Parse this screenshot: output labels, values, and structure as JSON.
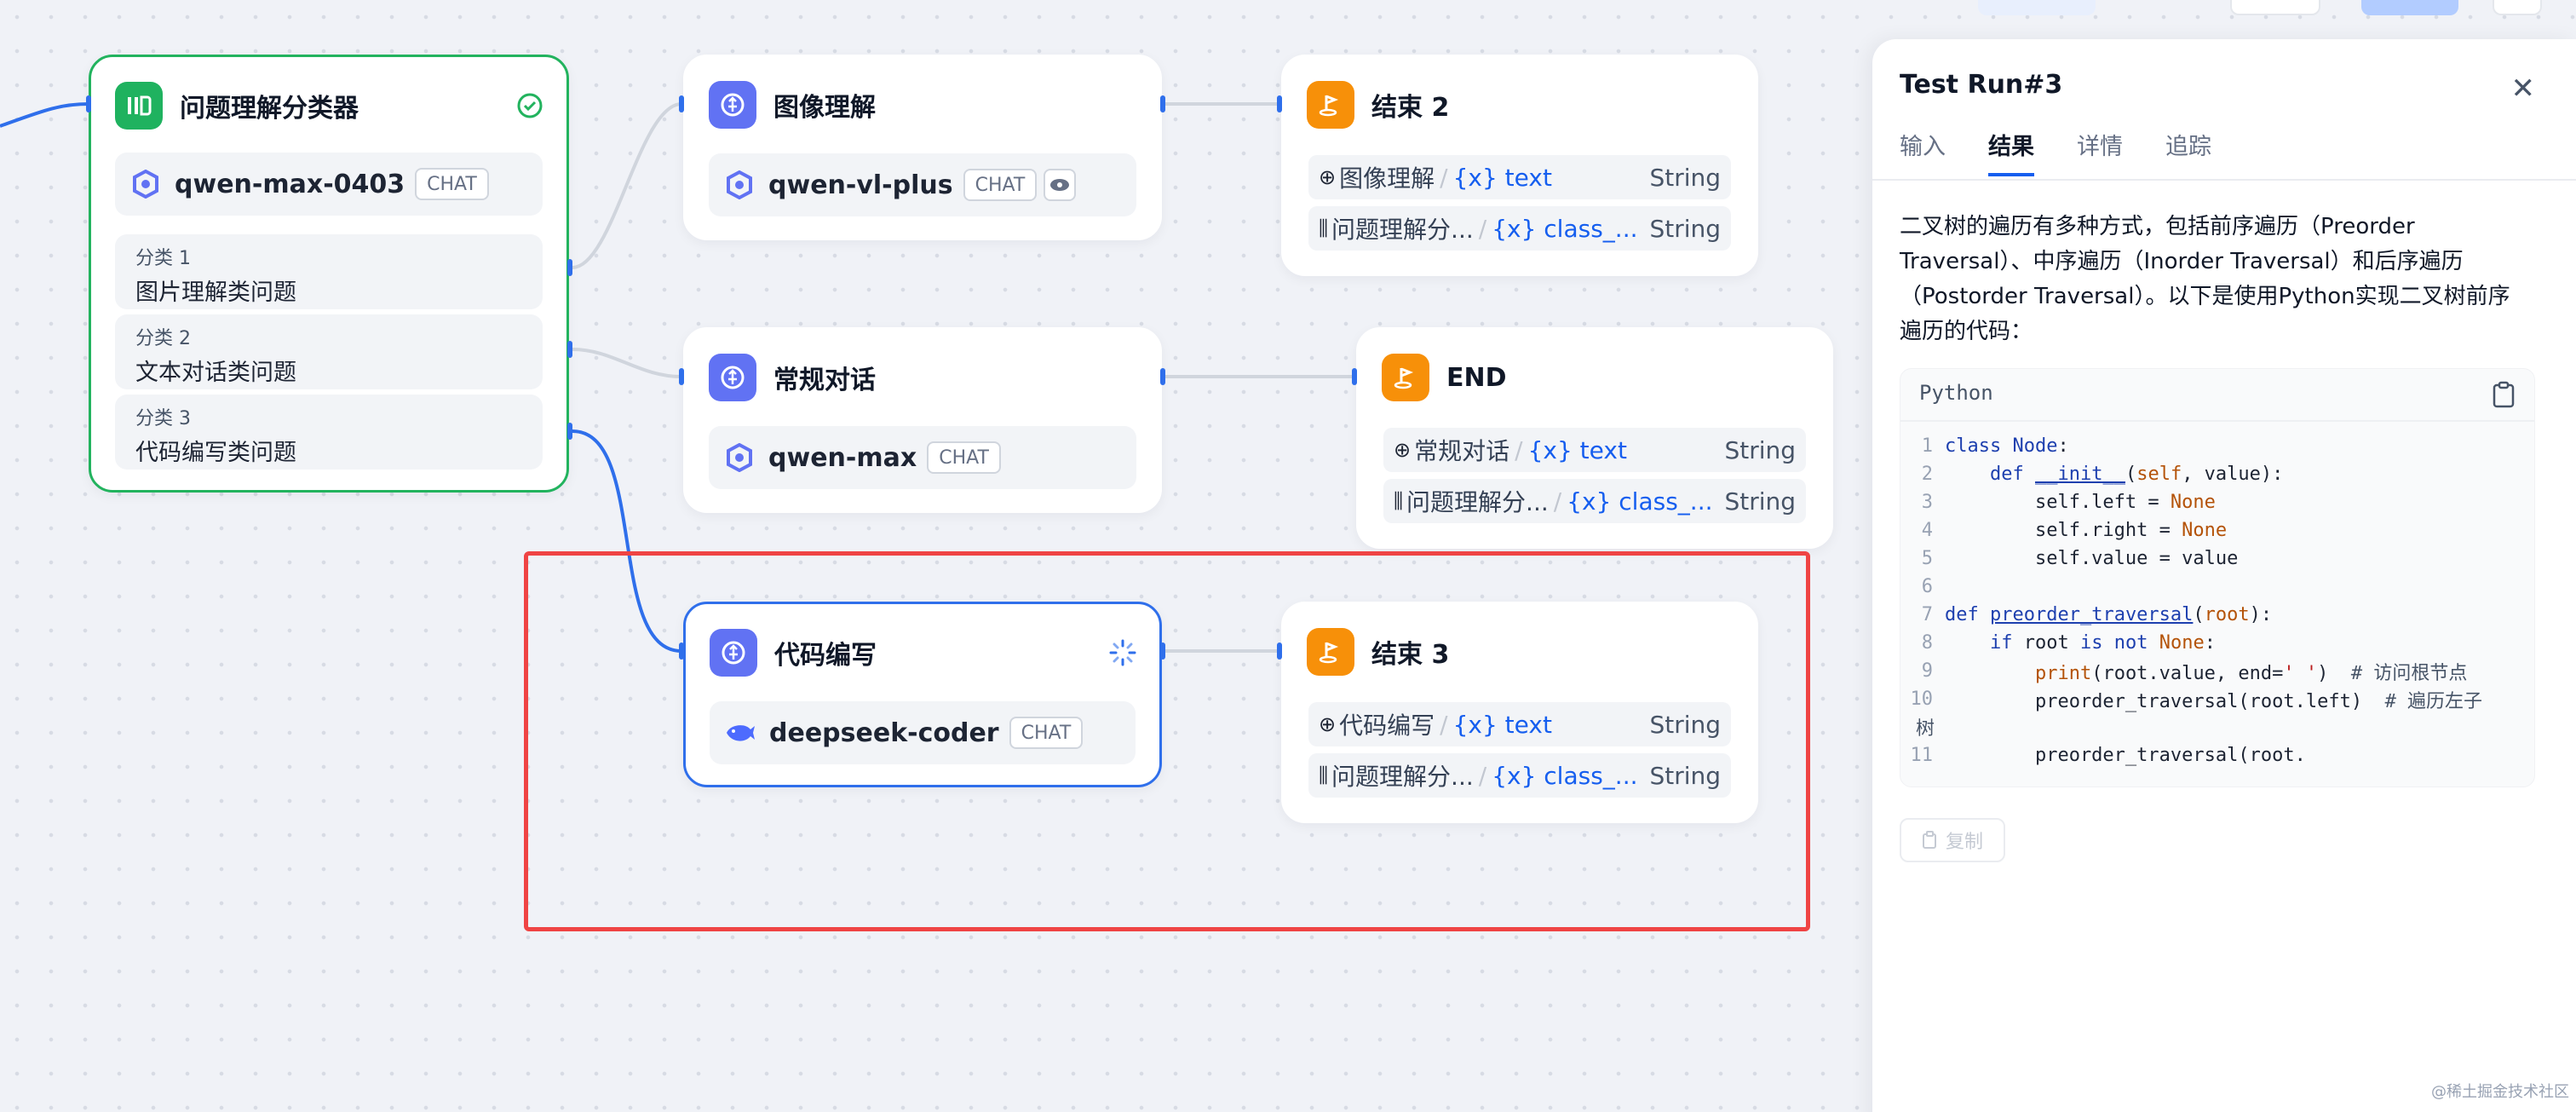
{
  "nodes": {
    "classifier": {
      "title": "问题理解分类器",
      "model": "qwen-max-0403",
      "model_badge": "CHAT",
      "classes": [
        {
          "label": "分类 1",
          "text": "图片理解类问题"
        },
        {
          "label": "分类 2",
          "text": "文本对话类问题"
        },
        {
          "label": "分类 3",
          "text": "代码编写类问题"
        }
      ]
    },
    "image": {
      "title": "图像理解",
      "model": "qwen-vl-plus",
      "model_badge": "CHAT"
    },
    "chat": {
      "title": "常规对话",
      "model": "qwen-max",
      "model_badge": "CHAT"
    },
    "code": {
      "title": "代码编写",
      "model": "deepseek-coder",
      "model_badge": "CHAT"
    },
    "end2": {
      "title": "结束 2",
      "vars": [
        {
          "source": "图像理解",
          "var": "{x} text",
          "type": "String"
        },
        {
          "source": "问题理解分...",
          "var": "{x} class_...",
          "type": "String"
        }
      ]
    },
    "end": {
      "title": "END",
      "vars": [
        {
          "source": "常规对话",
          "var": "{x} text",
          "type": "String"
        },
        {
          "source": "问题理解分...",
          "var": "{x} class_...",
          "type": "String"
        }
      ]
    },
    "end3": {
      "title": "结束 3",
      "vars": [
        {
          "source": "代码编写",
          "var": "{x} text",
          "type": "String"
        },
        {
          "source": "问题理解分...",
          "var": "{x} class_...",
          "type": "String"
        }
      ]
    }
  },
  "panel": {
    "title": "Test Run#3",
    "tabs": [
      "输入",
      "结果",
      "详情",
      "追踪"
    ],
    "active_tab": "结果",
    "result_lines": [
      "二叉树的遍历有多种方式，包括前序遍历（Preorder",
      "Traversal）、中序遍历（Inorder Traversal）和后序遍历",
      "（Postorder Traversal）。以下是使用Python实现二叉树前序",
      "遍历的代码："
    ],
    "code_language": "Python",
    "copy_label": "复制"
  },
  "watermark": "@稀土掘金技术社区",
  "colors": {
    "accent": "#155eef",
    "success": "#22b35e",
    "selection": "#ef4444",
    "end_node": "#f79009",
    "llm_node": "#6172f3"
  }
}
